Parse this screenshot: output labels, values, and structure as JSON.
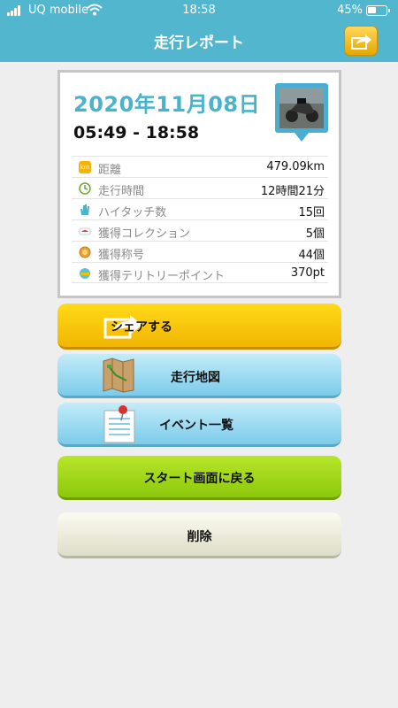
{
  "status_bar": {
    "carrier": "UQ mobile",
    "time": "18:58",
    "battery_percent": "45%",
    "battery_level": 0.45
  },
  "header": {
    "title": "走行レポート",
    "share_icon": "share-arrow-icon",
    "bg_color": "#52b6cf",
    "share_color": "#ffd85a"
  },
  "report": {
    "date": "2020年11月08日",
    "time_range": "05:49 - 18:58",
    "photo_icon": "motorcycle-photo-pin-icon",
    "stats": [
      {
        "icon": "km-icon",
        "label": "距離",
        "value": "479.09km"
      },
      {
        "icon": "clock-icon",
        "label": "走行時間",
        "value": "12時間21分"
      },
      {
        "icon": "hand-icon",
        "label": "ハイタッチ数",
        "value": "15回"
      },
      {
        "icon": "collection-icon",
        "label": "獲得コレクション",
        "value": "5個"
      },
      {
        "icon": "medal-icon",
        "label": "獲得称号",
        "value": "44個"
      },
      {
        "icon": "territory-icon",
        "label": "獲得テリトリーポイント",
        "value": "370pt"
      }
    ]
  },
  "buttons": {
    "share": "シェアする",
    "map": "走行地図",
    "events": "イベント一覧",
    "back_to_start": "スタート画面に戻る",
    "delete": "削除"
  },
  "colors": {
    "accent": "#4ab3cc",
    "share_button": "#ffd91a",
    "map_button": "#7ccbea",
    "start_button": "#8cc80c",
    "delete_button": "#deddc8"
  }
}
